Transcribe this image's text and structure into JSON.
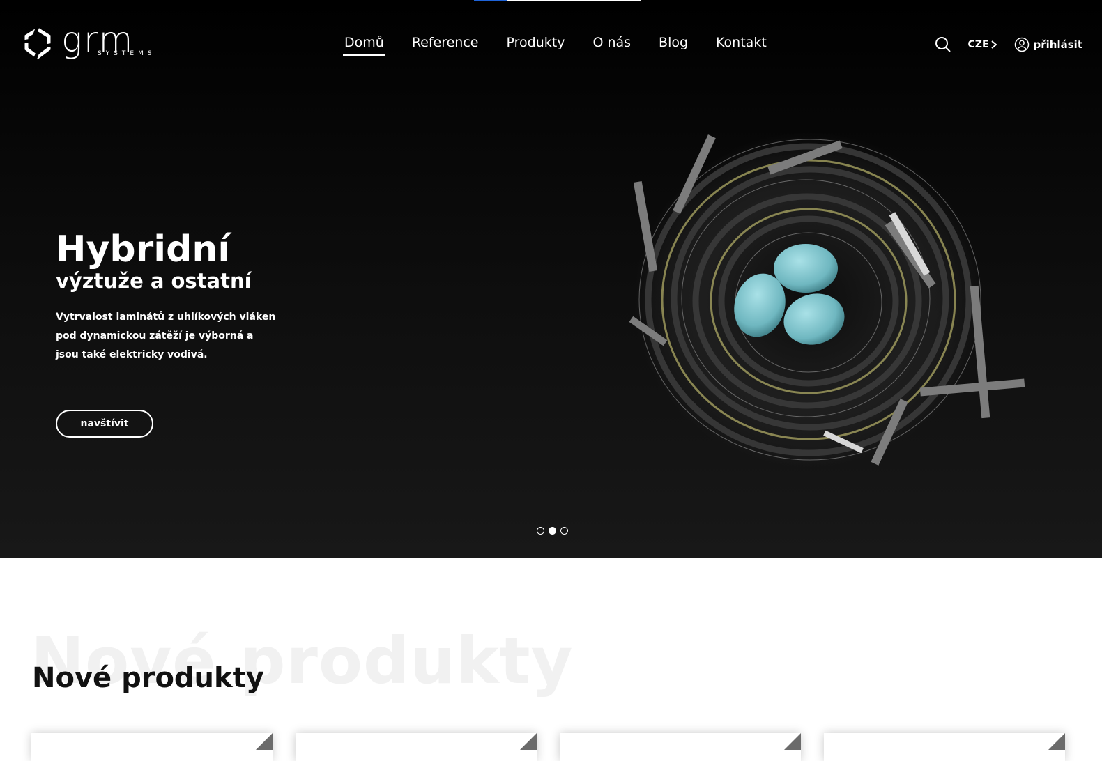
{
  "header": {
    "logo_name": "grm",
    "logo_sub": "SYSTEMS",
    "nav": [
      {
        "label": "Domů",
        "active": true
      },
      {
        "label": "Reference"
      },
      {
        "label": "Produkty"
      },
      {
        "label": "O nás"
      },
      {
        "label": "Blog"
      },
      {
        "label": "Kontakt"
      }
    ],
    "language": "CZE",
    "login_label": "přihlásit",
    "icons": {
      "search": "search-icon",
      "lang": "chevron-right-icon",
      "user": "user-circle-icon"
    }
  },
  "hero": {
    "title": "Hybridní",
    "subtitle": "výztuže a ostatní",
    "description": "Vytrvalost laminátů z uhlíkových vláken pod dynamickou zátěží je výborná a jsou také elektricky vodivá.",
    "button_label": "navštívit",
    "slides": 3,
    "active_slide": 2
  },
  "products": {
    "watermark": "Nové produkty",
    "title": "Nové produkty",
    "cards": 4
  },
  "progress": 0.2,
  "colors": {
    "accent": "#1e63d8",
    "hero_bg": "#111111",
    "egg": "#7fc6cf"
  }
}
